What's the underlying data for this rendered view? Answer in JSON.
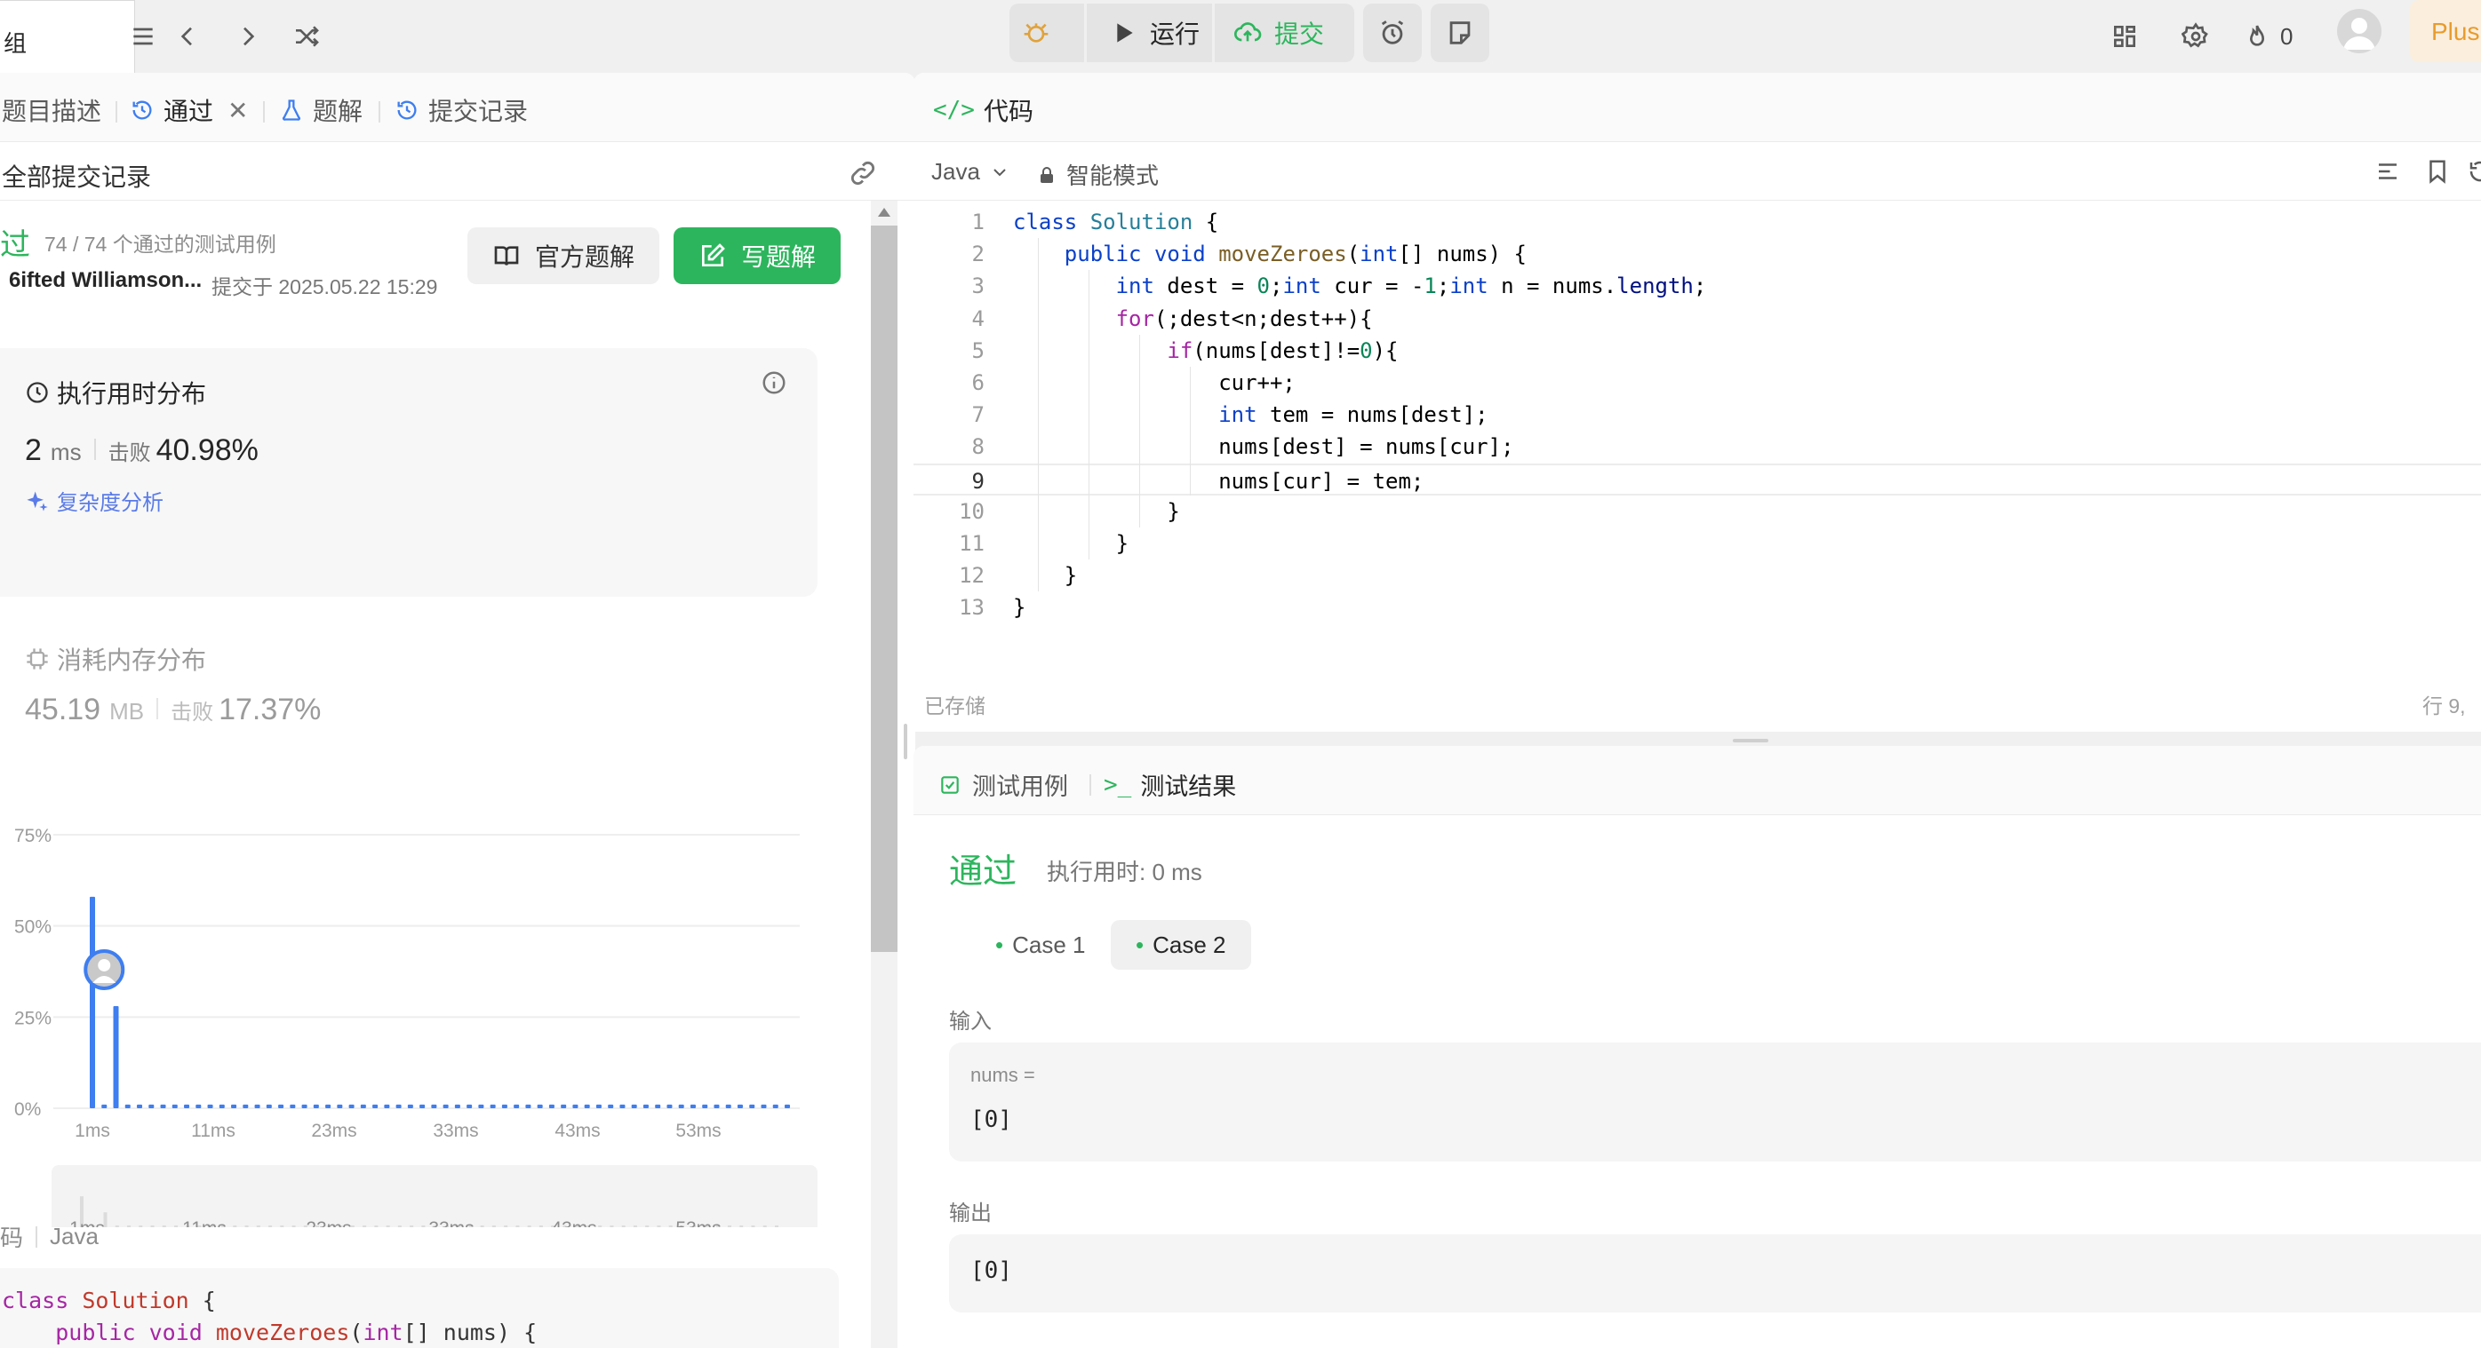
{
  "topbar": {
    "list_label": "组",
    "run_label": "运行",
    "submit_label": "提交",
    "streak_count": "0",
    "plus_label": "Plus"
  },
  "left": {
    "tabs": {
      "description": "题目描述",
      "passed": "通过",
      "solutions": "题解",
      "submissions": "提交记录"
    },
    "all_submissions": "全部提交记录",
    "status": "过",
    "testcases": "74 / 74 个通过的测试用例",
    "user": "6ifted Williamson...",
    "submitted_at": "提交于 2025.05.22 15:29",
    "official_solution": "官方题解",
    "write_solution": "写题解",
    "runtime": {
      "title": "执行用时分布",
      "value": "2",
      "unit": "ms",
      "beat_label": "击败",
      "beat_value": "40.98%",
      "complexity": "复杂度分析"
    },
    "memory": {
      "title": "消耗内存分布",
      "value": "45.19",
      "unit": "MB",
      "beat_label": "击败",
      "beat_value": "17.37%"
    },
    "code_label": "码",
    "code_lang": "Java",
    "code_preview": [
      "class Solution {",
      "    public void moveZeroes(int[] nums) {"
    ]
  },
  "chart_data": {
    "type": "bar",
    "x_ticks": [
      "1ms",
      "11ms",
      "23ms",
      "33ms",
      "43ms",
      "53ms"
    ],
    "y_ticks": [
      "0%",
      "25%",
      "50%",
      "75%"
    ],
    "ylim": [
      0,
      75
    ],
    "values": [
      58,
      0,
      28,
      1,
      1,
      1,
      1,
      1,
      1,
      1,
      1,
      1,
      1,
      1,
      1,
      1,
      1,
      1,
      1,
      1,
      1,
      1,
      1,
      1,
      1,
      1,
      1,
      1,
      1,
      1,
      1,
      1,
      1,
      1,
      1,
      1,
      1,
      1,
      1,
      1,
      1,
      1,
      1,
      1,
      1,
      1,
      1,
      1,
      1,
      1,
      1,
      1,
      1,
      1,
      1,
      1,
      1,
      1,
      1,
      1
    ],
    "marker_index": 1,
    "marker_value": 38,
    "bar_color": "#3e7ef0"
  },
  "code": {
    "title": "代码",
    "language": "Java",
    "mode": "智能模式",
    "saved": "已存储",
    "cursor_pos": "行 9,",
    "lines": [
      "class Solution {",
      "    public void moveZeroes(int[] nums) {",
      "        int dest = 0;int cur = -1;int n = nums.length;",
      "        for(;dest<n;dest++){",
      "            if(nums[dest]!=0){",
      "                cur++;",
      "                int tem = nums[dest];",
      "                nums[dest] = nums[cur];",
      "                nums[cur] = tem;",
      "            }",
      "        }",
      "    }",
      "}"
    ]
  },
  "test": {
    "tab_cases": "测试用例",
    "tab_results": "测试结果",
    "result": "通过",
    "runtime_label": "执行用时: 0 ms",
    "case1": "Case 1",
    "case2": "Case 2",
    "input_label": "输入",
    "var_label": "nums =",
    "input_value": "[0]",
    "output_label": "输出",
    "output_value": "[0]"
  },
  "colors": {
    "accent_green": "#2db55d",
    "blue": "#3e7ef0",
    "plus": "#e89b2c"
  }
}
